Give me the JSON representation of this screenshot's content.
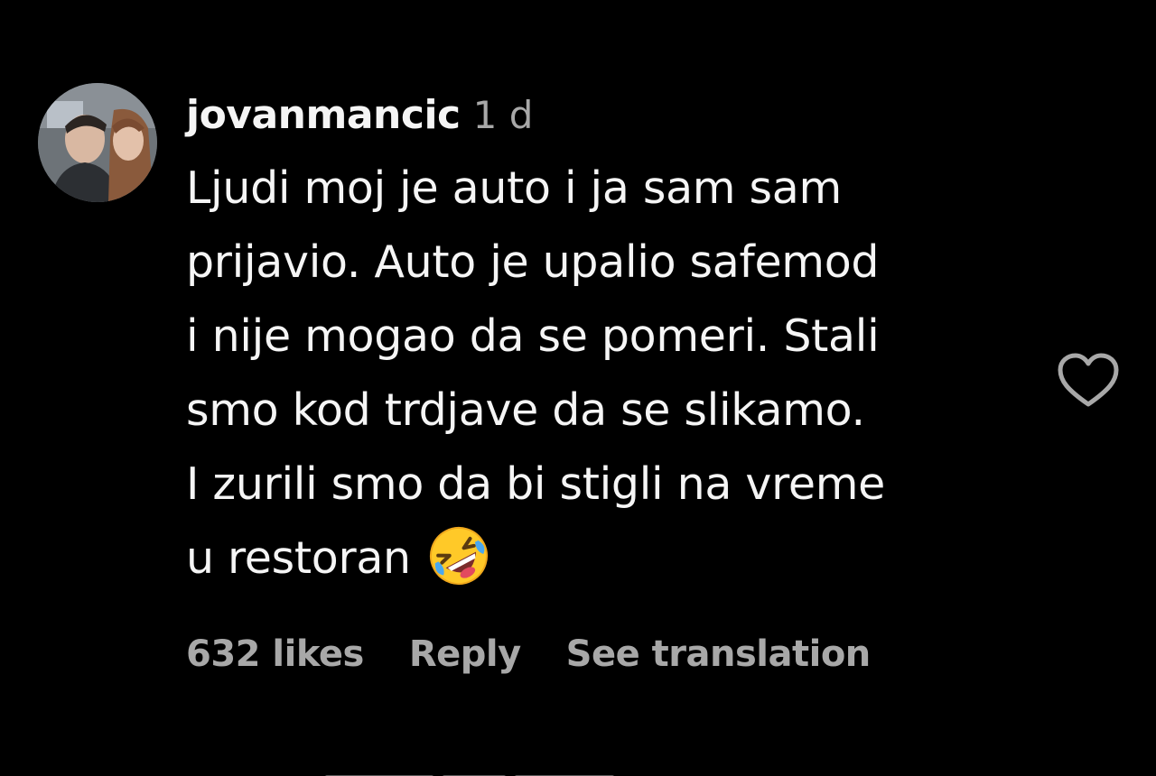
{
  "comment": {
    "username": "jovanmancic",
    "time": "1 d",
    "text_lines": [
      "Ljudi moj je auto i ja sam sam",
      "prijavio. Auto je upalio safemod",
      "i nije mogao da se pomeri. Stali",
      "smo kod trdjave da se slikamo.",
      "I zurili smo da bi stigli na vreme",
      "u restoran"
    ],
    "emoji": "rolling-on-floor-laughing-emoji",
    "likes": "632 likes",
    "reply_label": "Reply",
    "translate_label": "See translation",
    "like_icon": "heart-icon"
  },
  "colors": {
    "background": "#000000",
    "primary_text": "#f5f5f5",
    "secondary_text": "#a8a8a8"
  }
}
